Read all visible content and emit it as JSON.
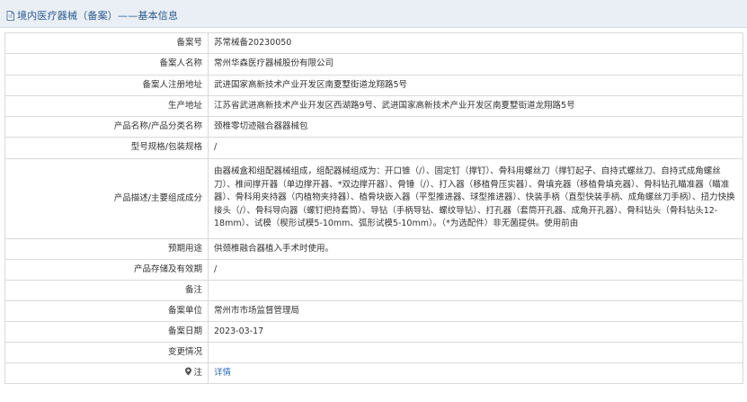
{
  "header": {
    "title": "境内医疗器械（备案）——基本信息",
    "icon": "document-icon"
  },
  "rows": [
    {
      "label": "备案号",
      "value": "苏常械备20230050"
    },
    {
      "label": "备案人名称",
      "value": "常州华森医疗器械股份有限公司"
    },
    {
      "label": "备案人注册地址",
      "value": "武进国家高新技术产业开发区南夏墅街道龙翔路5号"
    },
    {
      "label": "生产地址",
      "value": "江苏省武进高新技术产业开发区西湖路9号、武进国家高新技术产业开发区南夏墅街道龙翔路5号"
    },
    {
      "label": "产品名称/产品分类名称",
      "value": "颈椎零切迹融合器器械包"
    },
    {
      "label": "型号规格/包装规格",
      "value": "/"
    },
    {
      "label": "产品描述/主要组成成分",
      "value": "由器械盒和组配器械组成，组配器械组成为：开口锥（/）、固定钉（撑钉）、骨科用螺丝刀（撑钉起子、自持式螺丝刀、自持式成角螺丝刀）、椎间撑开器（单边撑开器、*双边撑开器）、骨锤（/）、打入器（移植骨压实器）、骨填充器（移植骨填充器）、骨科钻孔瞄准器（瞄准器）、骨科用夹持器（内植物夹持器）、植骨块嵌入器（平型推进器、球型推进器）、快装手柄（直型快装手柄、成角螺丝刀手柄）、扭力快换接头（/）、骨科导向器（螺钉把持套筒）、导钻（手柄导钻、螺纹导钻）、打孔器（套筒开孔器、成角开孔器）、骨科钻头（骨科钻头12-18mm）、试模（楔形试模5-10mm、弧形试模5-10mm）。（*为选配件）非无菌提供。使用前由"
    },
    {
      "label": "预期用途",
      "value": "供颈椎融合器植入手术时使用。"
    },
    {
      "label": "产品存储及有效期",
      "value": "/"
    },
    {
      "label": "备注",
      "value": ""
    },
    {
      "label": "备案单位",
      "value": "常州市市场监督管理局"
    },
    {
      "label": "备案日期",
      "value": "2023-03-17"
    },
    {
      "label": "变更情况",
      "value": ""
    }
  ],
  "detail_row": {
    "label": "注",
    "label_icon": "location-marker-icon",
    "link_text": "详情"
  },
  "colors": {
    "header_bg": "#e9eff5",
    "header_text": "#2b5a8f",
    "border": "#d9d9d9",
    "link": "#2e6db4"
  }
}
